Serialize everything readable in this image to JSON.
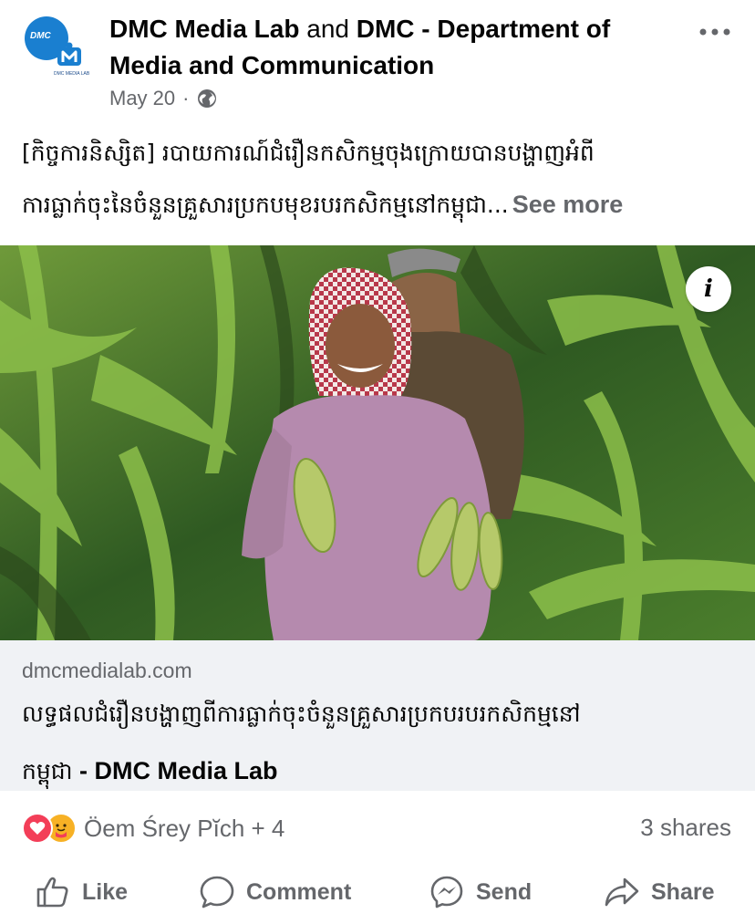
{
  "header": {
    "page_name_1": "DMC Media Lab",
    "conjunction": " and ",
    "page_name_2": "DMC - Department of Media and Communication",
    "date": "May 20",
    "separator": "·",
    "privacy_icon": "globe-icon",
    "avatar_text": "DMC",
    "avatar_sub": "DMC MEDIA LAB"
  },
  "post": {
    "text_line_1": "[កិច្ចការនិស្សិត] របាយការណ៍ជំរឿនកសិកម្មចុងក្រោយបានបង្ហាញអំពី",
    "text_line_2": "ការធ្លាក់ចុះនៃចំនួនគ្រួសារប្រកបមុខរបរកសិកម្មនៅកម្ពុជា...",
    "see_more": "See more"
  },
  "link": {
    "domain": "dmcmedialab.com",
    "title_line_1": "លទ្ធផលជំរឿនបង្ហាញពីការធ្លាក់ចុះចំនួនគ្រួសារប្រកបរបរកសិកម្មនៅ",
    "title_line_2": "កម្ពុជា",
    "title_suffix": " - DMC Media Lab"
  },
  "reactions": {
    "names": "Öem Śrey Pĭch + 4",
    "shares": "3 shares",
    "icons": [
      "love-icon",
      "care-icon"
    ]
  },
  "actions": {
    "like": "Like",
    "comment": "Comment",
    "send": "Send",
    "share": "Share"
  },
  "colors": {
    "text_primary": "#050505",
    "text_secondary": "#65676b",
    "card_bg": "#f0f2f5",
    "love": "#f33e58",
    "care": "#f7b125",
    "brand_blue": "#1a7fd0"
  }
}
